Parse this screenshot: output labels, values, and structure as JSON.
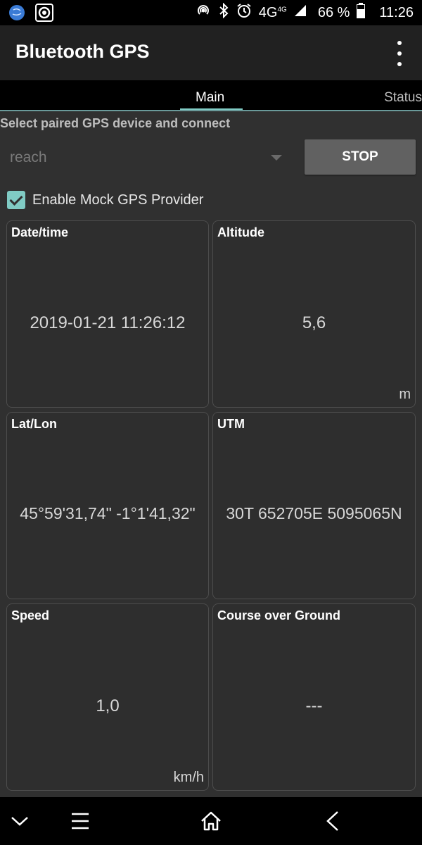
{
  "statusbar": {
    "network": "4G",
    "network_sup": "4G",
    "battery": "66 %",
    "time": "11:26",
    "icons": [
      "app-globe-icon",
      "gps-app-icon",
      "hotspot-icon",
      "bluetooth-icon",
      "alarm-icon",
      "signal-icon",
      "battery-icon"
    ]
  },
  "appbar": {
    "title": "Bluetooth GPS",
    "menu_icon": "overflow-menu-icon"
  },
  "tabs": [
    {
      "label": "Main",
      "active": true
    },
    {
      "label": "Status",
      "active": false
    }
  ],
  "main": {
    "section_label": "Select paired GPS device and connect",
    "device": "reach",
    "stop_label": "STOP",
    "mock_label": "Enable Mock GPS Provider",
    "mock_checked": true,
    "cards": {
      "datetime": {
        "title": "Date/time",
        "value": "2019-01-21 11:26:12",
        "unit": ""
      },
      "altitude": {
        "title": "Altitude",
        "value": "5,6",
        "unit": "m"
      },
      "latlon": {
        "title": "Lat/Lon",
        "value": "45°59'31,74\" -1°1'41,32\"",
        "unit": ""
      },
      "utm": {
        "title": "UTM",
        "value": "30T 652705E 5095065N",
        "unit": ""
      },
      "speed": {
        "title": "Speed",
        "value": "1,0",
        "unit": "km/h"
      },
      "course": {
        "title": "Course over Ground",
        "value": "---",
        "unit": ""
      }
    }
  },
  "colors": {
    "accent": "#80cbc4",
    "background": "#303030",
    "appbar": "#212121"
  },
  "navbar": {
    "icons": [
      "chevron-down-icon",
      "menu-icon",
      "home-icon",
      "back-icon"
    ]
  }
}
